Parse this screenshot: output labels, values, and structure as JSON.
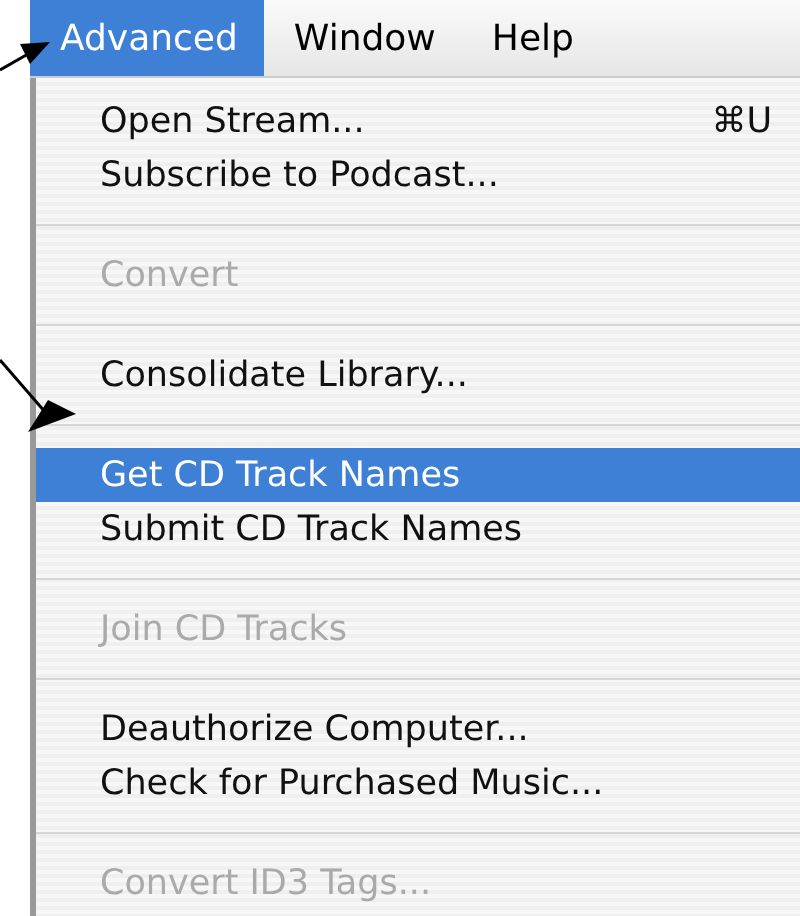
{
  "menu_bar": [
    {
      "label": "Advanced",
      "selected": true
    },
    {
      "label": "Window",
      "selected": false
    },
    {
      "label": "Help",
      "selected": false
    }
  ],
  "menu": {
    "items": [
      {
        "kind": "item",
        "label": "Open Stream...",
        "shortcut": "⌘U",
        "disabled": false,
        "selected": false
      },
      {
        "kind": "item",
        "label": "Subscribe to Podcast...",
        "disabled": false,
        "selected": false
      },
      {
        "kind": "separator"
      },
      {
        "kind": "item",
        "label": "Convert",
        "disabled": true,
        "selected": false
      },
      {
        "kind": "separator"
      },
      {
        "kind": "item",
        "label": "Consolidate Library...",
        "disabled": false,
        "selected": false
      },
      {
        "kind": "separator"
      },
      {
        "kind": "item",
        "label": "Get CD Track Names",
        "disabled": false,
        "selected": true
      },
      {
        "kind": "item",
        "label": "Submit CD Track Names",
        "disabled": false,
        "selected": false
      },
      {
        "kind": "separator"
      },
      {
        "kind": "item",
        "label": "Join CD Tracks",
        "disabled": true,
        "selected": false
      },
      {
        "kind": "separator"
      },
      {
        "kind": "item",
        "label": "Deauthorize Computer...",
        "disabled": false,
        "selected": false
      },
      {
        "kind": "item",
        "label": "Check for Purchased Music...",
        "disabled": false,
        "selected": false
      },
      {
        "kind": "separator"
      },
      {
        "kind": "item",
        "label": "Convert ID3 Tags...",
        "disabled": true,
        "selected": false
      }
    ]
  }
}
